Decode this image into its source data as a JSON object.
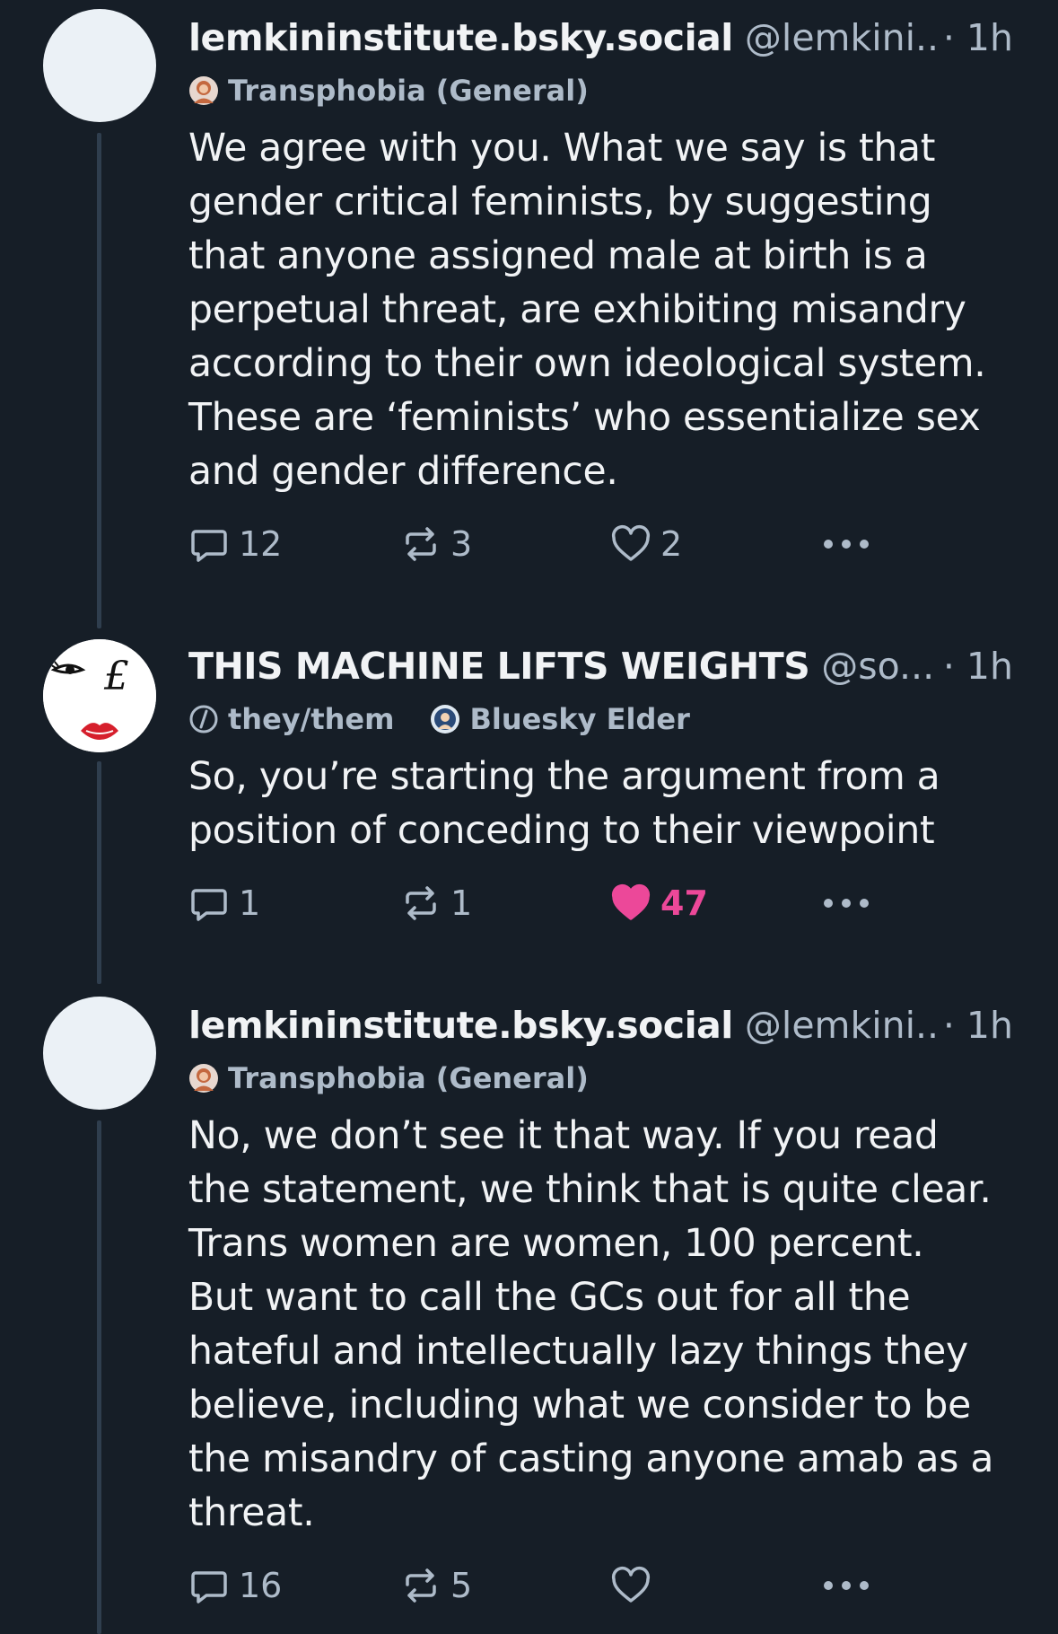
{
  "colors": {
    "background": "#161e27",
    "text_primary": "#f1f3f5",
    "text_secondary": "#aebbc9",
    "thread_line": "#2f3e4e",
    "like_active": "#ec4899"
  },
  "posts": [
    {
      "display_name": "lemkininstitute.bsky.social",
      "handle": "@lemkini...",
      "time": "· 1h",
      "labels": [
        {
          "text": "Transphobia (General)",
          "icon": "labeler-avatar-icon"
        }
      ],
      "text": "We agree with you. What we say is that\ngender critical feminists, by suggesting\nthat anyone assigned male at birth is a\nperpetual threat, are exhibiting misandry\naccording to their own ideological system.\nThese are ‘feminists’ who essentialize sex\nand gender difference.",
      "replies": "12",
      "reposts": "3",
      "likes": "2",
      "liked": false
    },
    {
      "display_name": "THIS MACHINE LIFTS WEIGHTS",
      "handle": "@so...",
      "time": "· 1h",
      "labels": [
        {
          "text": "they/them",
          "icon": "pronoun-icon"
        },
        {
          "text": "Bluesky Elder",
          "icon": "labeler-avatar-icon"
        }
      ],
      "text": "So, you’re starting the argument from a\nposition of conceding to their viewpoint",
      "replies": "1",
      "reposts": "1",
      "likes": "47",
      "liked": true
    },
    {
      "display_name": "lemkininstitute.bsky.social",
      "handle": "@lemkini...",
      "time": "· 1h",
      "labels": [
        {
          "text": "Transphobia (General)",
          "icon": "labeler-avatar-icon"
        }
      ],
      "text": "No, we don’t see it that way. If you read\nthe statement, we think that is quite clear.\nTrans women are women, 100 percent.\nBut want to call the GCs out for all the\nhateful and intellectually lazy things they\nbelieve, including what we consider to be\nthe misandry of casting anyone amab as a\nthreat.",
      "replies": "16",
      "reposts": "5",
      "likes": "",
      "liked": false
    }
  ]
}
